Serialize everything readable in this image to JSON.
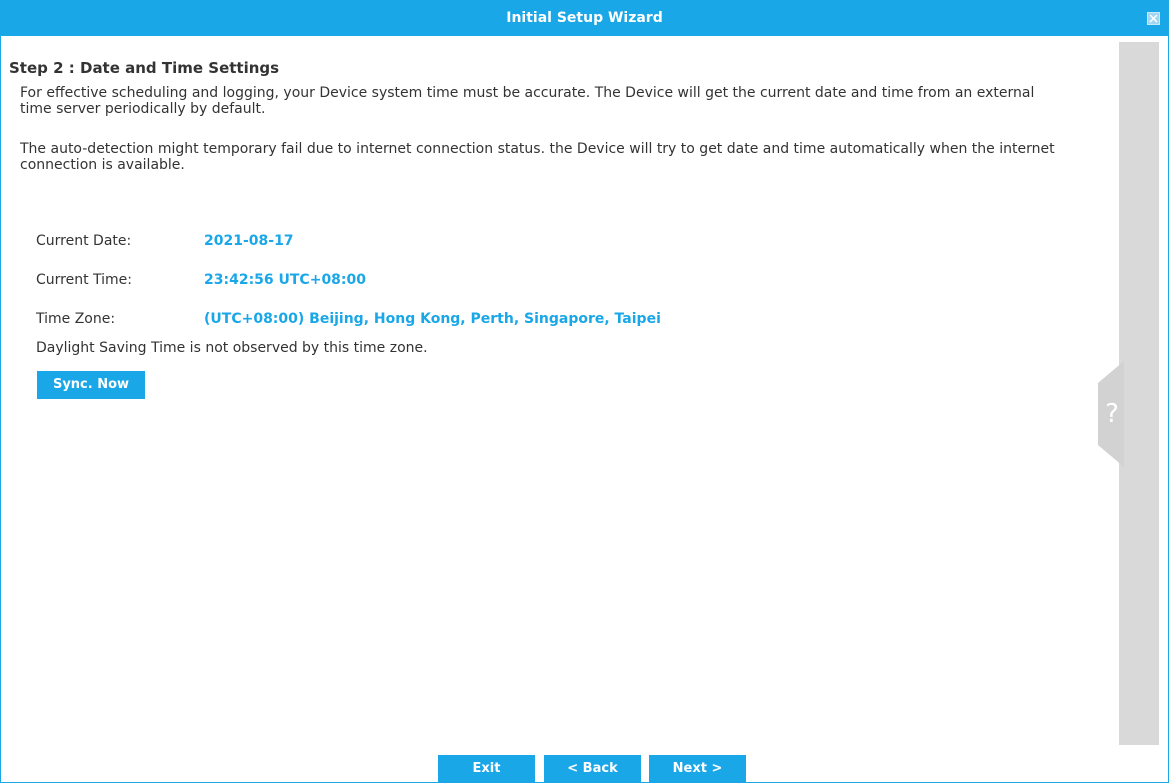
{
  "window": {
    "title": "Initial Setup Wizard"
  },
  "step": {
    "title": "Step 2 : Date and Time Settings",
    "paragraph1": "For effective scheduling and logging, your Device system time must be accurate. The Device will get the current date and time from an external time server periodically by default.",
    "paragraph2": "The auto-detection might temporary fail due to internet connection status. the Device will try to get date and time automatically when the internet connection is available."
  },
  "fields": [
    {
      "label": "Current Date:",
      "value": "2021-08-17"
    },
    {
      "label": "Current Time:",
      "value": "23:42:56 UTC+08:00"
    },
    {
      "label": "Time Zone:",
      "value": "(UTC+08:00) Beijing, Hong Kong, Perth, Singapore, Taipei"
    }
  ],
  "dst_note": "Daylight Saving Time is not observed by this time zone.",
  "buttons": {
    "sync": "Sync. Now",
    "exit": "Exit",
    "back": "< Back",
    "next": "Next >"
  },
  "help": {
    "glyph": "?"
  },
  "colors": {
    "accent": "#1aa7e8",
    "text": "#333333",
    "side_panel": "#d9d9d9"
  },
  "icons": {
    "close": "close-icon",
    "help": "help-icon"
  }
}
